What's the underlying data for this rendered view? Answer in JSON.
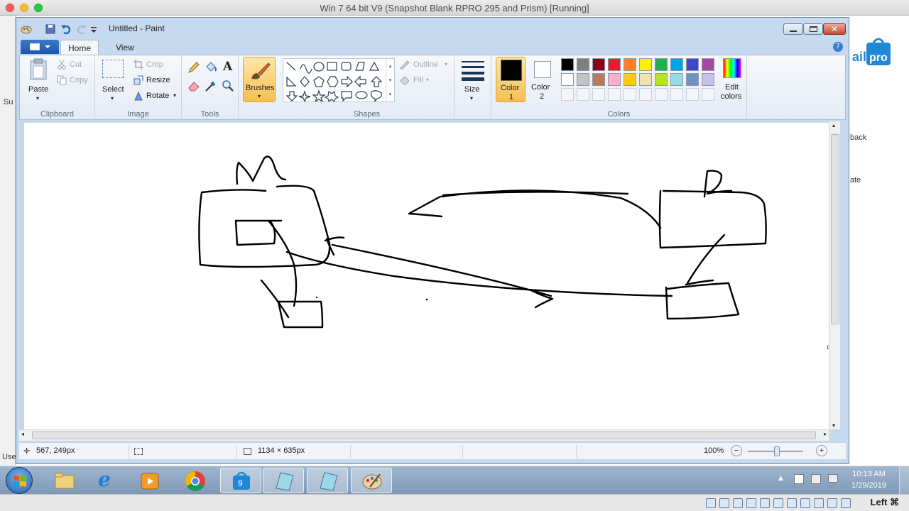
{
  "host": {
    "title": "Win 7 64 bit V9 (Snapshot Blank RPRO 295 and Prism) [Running]",
    "key_label": "Left ⌘"
  },
  "background_app": {
    "side_texts": [
      "back",
      "ate"
    ],
    "left_texts": [
      "Su",
      "Use"
    ],
    "logo_text": "ail pro"
  },
  "paint": {
    "title": "Untitled - Paint",
    "tabs": [
      "Home",
      "View"
    ],
    "clipboard": {
      "paste": "Paste",
      "cut": "Cut",
      "copy": "Copy",
      "label": "Clipboard"
    },
    "image": {
      "select": "Select",
      "crop": "Crop",
      "resize": "Resize",
      "rotate": "Rotate",
      "label": "Image"
    },
    "tools": {
      "label": "Tools"
    },
    "brushes": {
      "label": "Brushes"
    },
    "shapes": {
      "outline": "Outline",
      "fill": "Fill",
      "label": "Shapes"
    },
    "size": {
      "label": "Size"
    },
    "colors": {
      "color1_label": "Color\n1",
      "color1_line1": "Color",
      "color1_line2": "1",
      "color2_line1": "Color",
      "color2_line2": "2",
      "edit_line1": "Edit",
      "edit_line2": "colors",
      "label": "Colors",
      "color1": "#000000",
      "color2": "#ffffff",
      "palette_row1": [
        "#000000",
        "#7f7f7f",
        "#880015",
        "#ed1c24",
        "#ff7f27",
        "#fff200",
        "#22b14c",
        "#00a2e8",
        "#3f48cc",
        "#a349a4"
      ],
      "palette_row2": [
        "#ffffff",
        "#c3c3c3",
        "#b97a57",
        "#ffaec9",
        "#ffc90e",
        "#efe4b0",
        "#b5e61d",
        "#99d9ea",
        "#7092be",
        "#c8bfe7"
      ]
    },
    "status": {
      "cursor_pos": "567, 249px",
      "canvas_size": "1134 × 635px",
      "zoom": "100%"
    }
  },
  "taskbar": {
    "time": "10:13 AM",
    "date": "1/29/2019"
  }
}
